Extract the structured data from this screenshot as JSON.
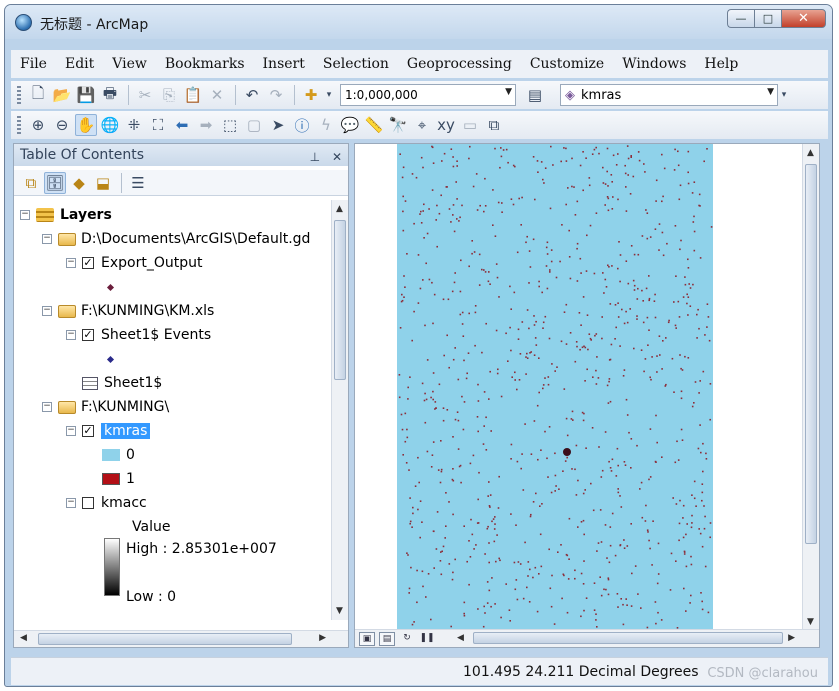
{
  "window": {
    "title": "无标题 - ArcMap",
    "minimize": "—",
    "maximize": "□",
    "close": "✕"
  },
  "menu": [
    "File",
    "Edit",
    "View",
    "Bookmarks",
    "Insert",
    "Selection",
    "Geoprocessing",
    "Customize",
    "Windows",
    "Help"
  ],
  "toolbar": {
    "scale": "1:0,000,000",
    "target_layer": "kmras"
  },
  "toc": {
    "title": "Table Of Contents",
    "pin": "⊥",
    "close": "✕",
    "root": "Layers",
    "gdb_path": "D:\\Documents\\ArcGIS\\Default.gd",
    "export_output": "Export_Output",
    "xls_path": "F:\\KUNMING\\KM.xls",
    "sheet_events": "Sheet1$ Events",
    "sheet_table": "Sheet1$",
    "folder_path": "F:\\KUNMING\\",
    "kmras": "kmras",
    "kmras_value_0": "0",
    "kmras_value_1": "1",
    "kmacc": "kmacc",
    "kmacc_value_label": "Value",
    "kmacc_high": "High : 2.85301e+007",
    "kmacc_low": "Low : 0"
  },
  "map": {
    "background": "#8fd2ea",
    "point_color": "#8c2d3a"
  },
  "status": {
    "coordinates": "101.495  24.211 Decimal Degrees",
    "watermark": "CSDN @clarahou"
  },
  "colors": {
    "kmras_0": "#8fd2ea",
    "kmras_1": "#b30f16",
    "export_point": "#6b1e3c",
    "events_point": "#2a2a8a",
    "selection": "#3399ff"
  }
}
